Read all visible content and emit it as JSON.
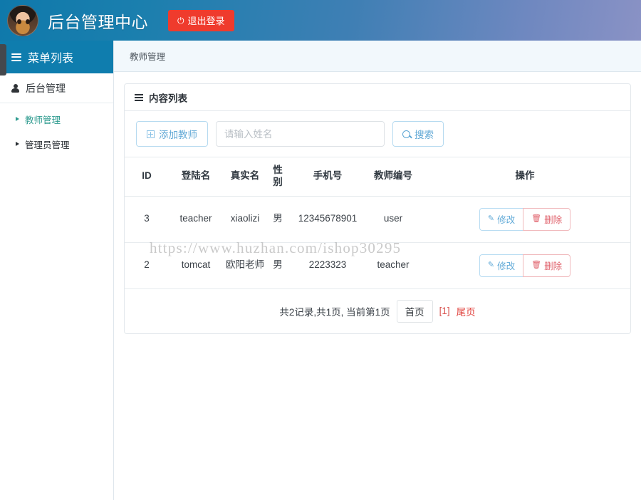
{
  "header": {
    "title": "后台管理中心",
    "logout_label": "退出登录",
    "logout_icon": "power-icon",
    "avatar_icon": "user-avatar",
    "accent_color": "#0f7dae",
    "logout_color": "#ef3b2d"
  },
  "sidebar": {
    "menu_header": "菜单列表",
    "menu_header_icon": "hamburger-icon",
    "group_label": "后台管理",
    "group_icon": "person-icon",
    "items": [
      {
        "label": "教师管理",
        "active": true
      },
      {
        "label": "管理员管理",
        "active": false
      }
    ],
    "active_color": "#2e9b8f"
  },
  "breadcrumb": {
    "current": "教师管理"
  },
  "panel": {
    "heading": "内容列表",
    "heading_icon": "list-icon"
  },
  "toolbar": {
    "add_label": "添加教师",
    "add_icon": "plus-square-icon",
    "search_placeholder": "请输入姓名",
    "search_value": "",
    "search_label": "搜索",
    "search_icon": "search-icon"
  },
  "table": {
    "columns": [
      "ID",
      "登陆名",
      "真实名",
      "性别",
      "手机号",
      "教师编号",
      "操作"
    ],
    "rows": [
      {
        "id": "3",
        "login": "teacher",
        "realname": "xiaolizi",
        "sex": "男",
        "phone": "12345678901",
        "code": "user"
      },
      {
        "id": "2",
        "login": "tomcat",
        "realname": "欧阳老师",
        "sex": "男",
        "phone": "2223323",
        "code": "teacher"
      }
    ],
    "edit_label": "修改",
    "edit_icon": "edit-icon",
    "delete_label": "删除",
    "delete_icon": "trash-icon"
  },
  "pagination": {
    "summary": "共2记录,共1页, 当前第1页",
    "first_label": "首页",
    "current_label": "[1]",
    "last_label": "尾页"
  },
  "watermark": {
    "text": "https://www.huzhan.com/ishop30295"
  }
}
